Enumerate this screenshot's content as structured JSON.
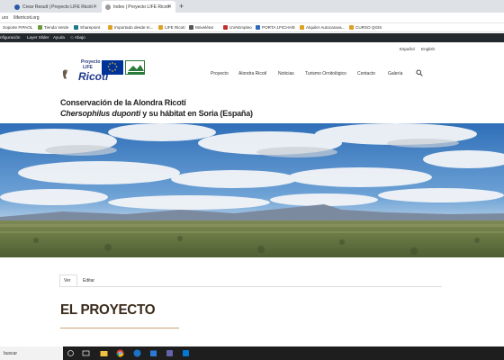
{
  "browser": {
    "tabs": [
      {
        "label": "Crear Result | Proyecto LIFE Ricoti"
      },
      {
        "label": "Index | Proyecto LIFE Ricoti"
      }
    ],
    "address": "lliferricoti.org",
    "address_prefix": "uro",
    "bookmarks": [
      "Soporte FIPAOL",
      "Tienda Verde",
      "Sharepoint",
      "Importado desde In...",
      "LIFE Ricoti",
      "Movelétar",
      "UVAEmpleo",
      "PORTA 1FICHA/E",
      "Alquiler Autocarava...",
      "CURSO QGIS"
    ]
  },
  "wpbar": {
    "items": [
      "nfiguración",
      "Layer Slider",
      "Ayuda",
      "Abajo"
    ]
  },
  "site": {
    "langs": [
      "Español",
      "English"
    ],
    "logo": {
      "line1": "Proyecto",
      "line2": "LIFE",
      "line3": "Ricotí"
    },
    "nav": [
      "Proyecto",
      "Alondra Ricotí",
      "Noticias",
      "Turismo Ornitológico",
      "Contacto",
      "Galería"
    ],
    "title1": "Conservación de la Alondra Ricotí",
    "title2_italic": "Chersophilus duponti",
    "title2_rest": " y su hábitat en Soria (España)",
    "editor_tabs": [
      "Ver",
      "Editar"
    ],
    "section_heading": "EL PROYECTO"
  },
  "taskbar": {
    "search_placeholder": "buscar"
  },
  "colors": {
    "tabstrip": "#dee1e6",
    "wpbar": "#23282d",
    "taskbar": "#1e1e1e",
    "heading_line": "#c8a070"
  }
}
